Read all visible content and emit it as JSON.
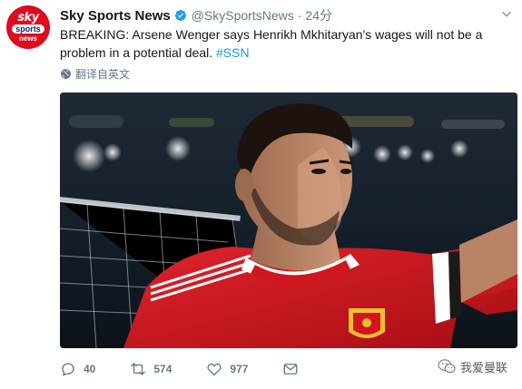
{
  "tweet": {
    "avatar": {
      "logo_line1": "sky",
      "logo_line2": "sports",
      "logo_line3": "news"
    },
    "author_name": "Sky Sports News",
    "handle": "@SkySportsNews",
    "separator": "·",
    "time": "24分",
    "text_prefix": "BREAKING: Arsene Wenger says Henrikh Mkhitaryan's wages will not be a problem in a potential deal. ",
    "hashtag": "#SSN",
    "translate_label": "翻译自英文",
    "actions": {
      "reply_count": "40",
      "retweet_count": "574",
      "like_count": "977"
    }
  },
  "watermark": {
    "text": "我爱曼联"
  },
  "colors": {
    "accent": "#1b95e0",
    "sky_red": "#e10a1f",
    "muted": "#657786",
    "jersey_red": "#d1161e"
  },
  "icons": [
    "verified-badge-icon",
    "chevron-down-icon",
    "globe-icon",
    "reply-icon",
    "retweet-icon",
    "like-icon",
    "direct-message-icon",
    "wechat-icon"
  ]
}
